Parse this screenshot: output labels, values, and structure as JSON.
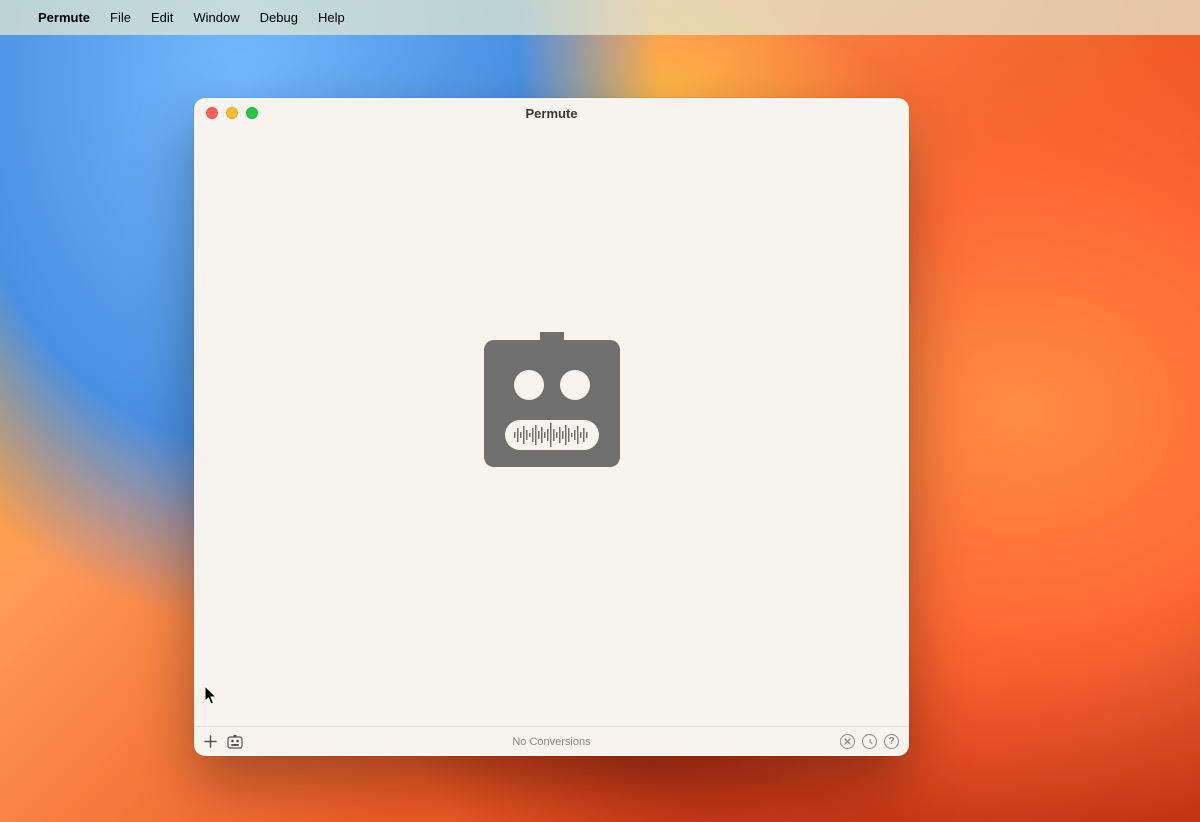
{
  "menubar": {
    "app_name": "Permute",
    "items": [
      "File",
      "Edit",
      "Window",
      "Debug",
      "Help"
    ]
  },
  "window": {
    "title": "Permute"
  },
  "toolbar": {
    "status_text": "No Conversions"
  }
}
